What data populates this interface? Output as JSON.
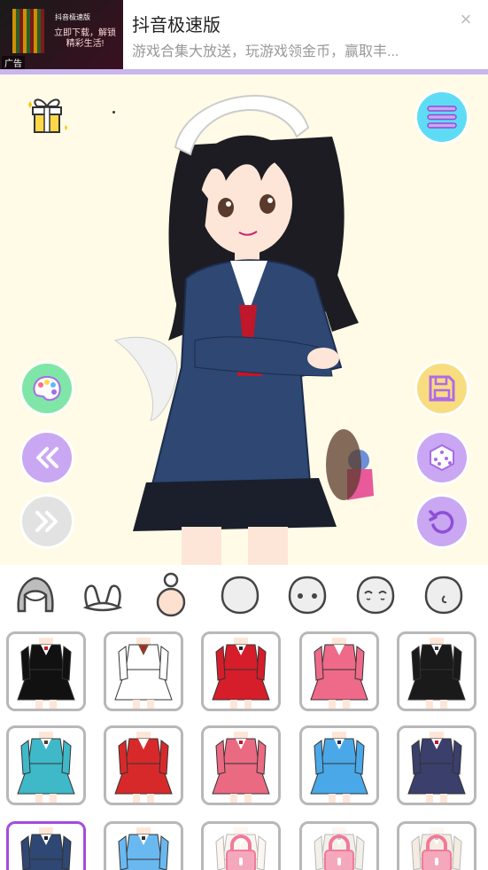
{
  "ad": {
    "title": "抖音极速版",
    "subtitle": "游戏合集大放送，玩游戏领金币，赢取丰...",
    "thumb_brand": "抖音极速版",
    "thumb_text": "立即下载，解锁精彩生活!",
    "label": "广告",
    "close_glyph": "×"
  },
  "colors": {
    "stage_bg": "#fffbe6",
    "accent_purple": "#c9a7f2",
    "menu_cyan": "#5fdcf5",
    "palette_green": "#7fe6a8",
    "save_yellow": "#f8dd80",
    "card_border": "#b8b8b8",
    "card_selected": "#a44be0"
  },
  "stage_buttons": {
    "left": [
      "palette-icon",
      "rewind-icon",
      "fast-forward-icon"
    ],
    "right": [
      "menu-icon",
      "save-icon",
      "dice-icon",
      "undo-icon"
    ],
    "top_left": "gift-icon"
  },
  "tabs": [
    "hair-back-icon",
    "bunny-ears-icon",
    "body-icon",
    "head-icon",
    "face-eyes-icon",
    "face-closed-eyes-icon",
    "face-side-icon"
  ],
  "selected_tab": 2,
  "outfits": [
    {
      "style": "bunny-black",
      "locked": false,
      "selected": false
    },
    {
      "style": "bunny-white",
      "locked": false,
      "selected": false
    },
    {
      "style": "bunny-red",
      "locked": false,
      "selected": false
    },
    {
      "style": "maid-pink",
      "locked": false,
      "selected": false
    },
    {
      "style": "gothic-black",
      "locked": false,
      "selected": false
    },
    {
      "style": "dress-teal",
      "locked": false,
      "selected": false
    },
    {
      "style": "dress-red-apron",
      "locked": false,
      "selected": false
    },
    {
      "style": "dress-pink",
      "locked": false,
      "selected": false
    },
    {
      "style": "dress-blue",
      "locked": false,
      "selected": false
    },
    {
      "style": "sailor-navy",
      "locked": false,
      "selected": false
    },
    {
      "style": "jacket-navy",
      "locked": false,
      "selected": true
    },
    {
      "style": "dress-light-blue",
      "locked": false,
      "selected": false
    },
    {
      "style": "locked-1",
      "locked": true,
      "selected": false
    },
    {
      "style": "locked-2",
      "locked": true,
      "selected": false
    },
    {
      "style": "locked-3",
      "locked": true,
      "selected": false
    }
  ]
}
